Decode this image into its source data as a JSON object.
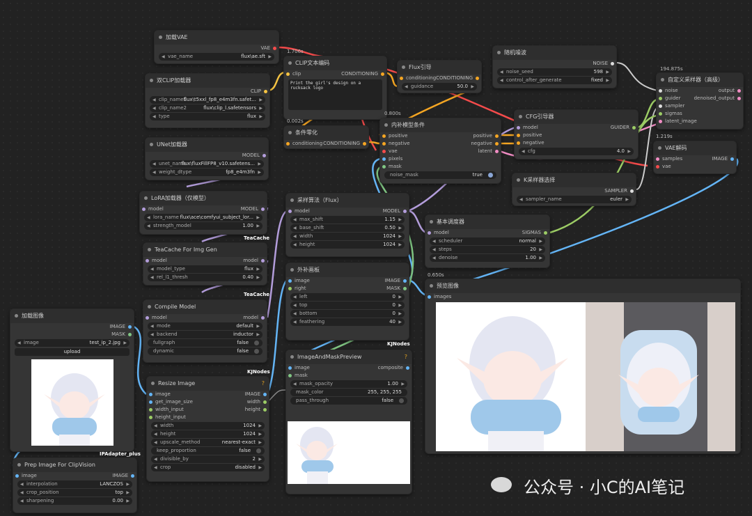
{
  "colors": {
    "model": "#b39ddb",
    "clip": "#f5c342",
    "vae": "#f44b4b",
    "conditioning": "#f5a623",
    "latent": "#f28dc4",
    "image": "#64b5f6",
    "mask": "#81c784",
    "sigmas": "#ffffff",
    "guider": "#9ccc65",
    "sampler": "#ffffff",
    "noise": "#ffffff"
  },
  "nodes": {
    "vae_loader": {
      "title": "加载VAE",
      "out": "VAE",
      "vae_name_k": "vae_name",
      "vae_name_v": "flux\\ae.sft"
    },
    "dual_clip": {
      "title": "双CLIP加载器",
      "out": "CLIP",
      "clip1_k": "clip_name1",
      "clip1_v": "flux\\t5xxl_fp8_e4m3fn.safet...",
      "clip2_k": "clip_name2",
      "clip2_v": "flux\\clip_l.safetensors",
      "type_k": "type",
      "type_v": "flux"
    },
    "unet": {
      "title": "UNet加载器",
      "out": "MODEL",
      "unet_k": "unet_name",
      "unet_v": "flux\\fluxFillFP8_v10.safetens...",
      "dtype_k": "weight_dtype",
      "dtype_v": "fp8_e4m3fn"
    },
    "lora": {
      "title": "LoRA加载器（仅模型）",
      "in": "model",
      "out": "MODEL",
      "lora_k": "lora_name",
      "lora_v": "flux\\ace\\comfyui_subject_lor...",
      "str_k": "strength_model",
      "str_v": "1.00",
      "tag": "TeaCache"
    },
    "teacache": {
      "title": "TeaCache For Img Gen",
      "in": "model",
      "out": "model",
      "mt_k": "model_type",
      "mt_v": "flux",
      "rel_k": "rel_l1_thresh",
      "rel_v": "0.40",
      "tag": "TeaCache"
    },
    "compile": {
      "title": "Compile Model",
      "in": "model",
      "out": "model",
      "mode_k": "mode",
      "mode_v": "default",
      "backend_k": "backend",
      "backend_v": "inductor",
      "fg_k": "fullgraph",
      "fg_v": "false",
      "dyn_k": "dynamic",
      "dyn_v": "false",
      "tag": "KJNodes"
    },
    "load_image": {
      "title": "加载图像",
      "out1": "IMAGE",
      "out2": "MASK",
      "img_k": "image",
      "img_v": "test_ip_2.jpg",
      "upload": "upload",
      "tag": "IPAdapter_plus"
    },
    "prep_image": {
      "title": "Prep Image For ClipVision",
      "in": "image",
      "out": "IMAGE",
      "interp_k": "interpolation",
      "interp_v": "LANCZOS",
      "crop_k": "crop_position",
      "crop_v": "top",
      "sharp_k": "sharpening",
      "sharp_v": "0.00"
    },
    "resize": {
      "title": "Resize Image",
      "in1": "image",
      "in2": "get_image_size",
      "in3": "width_input",
      "in4": "height_input",
      "out1": "IMAGE",
      "out2": "width",
      "out3": "height",
      "w_k": "width",
      "w_v": "1024",
      "h_k": "height",
      "h_v": "1024",
      "up_k": "upscale_method",
      "up_v": "nearest-exact",
      "kp_k": "keep_proportion",
      "kp_v": "false",
      "div_k": "divisible_by",
      "div_v": "2",
      "crop_k": "crop",
      "crop_v": "disabled",
      "help": "?"
    },
    "clip_text": {
      "title": "CLIP文本编码",
      "in": "clip",
      "out": "CONDITIONING",
      "text": "Print the girl's design on a rucksack logo",
      "badge": "1.706s"
    },
    "cond_zero": {
      "title": "条件零化",
      "in": "conditioning",
      "out": "CONDITIONING",
      "badge": "0.002s"
    },
    "flux_guidance": {
      "title": "Flux引导",
      "in": "conditioning",
      "out": "CONDITIONING",
      "g_k": "guidance",
      "g_v": "50.0"
    },
    "inpaint_cond": {
      "title": "内补模型条件",
      "badge": "0.800s",
      "in1": "positive",
      "in2": "negative",
      "in3": "vae",
      "in4": "pixels",
      "in5": "mask",
      "out1": "positive",
      "out2": "negative",
      "out3": "latent",
      "nm_k": "noise_mask",
      "nm_v": "true"
    },
    "random_noise": {
      "title": "随机噪波",
      "out": "NOISE",
      "seed_k": "noise_seed",
      "seed_v": "598",
      "ctrl_k": "control_after_generate",
      "ctrl_v": "fixed"
    },
    "cfg_guider": {
      "title": "CFG引导器",
      "in1": "model",
      "in2": "positive",
      "in3": "negative",
      "out": "GUIDER",
      "cfg_k": "cfg",
      "cfg_v": "4.0"
    },
    "custom_sampler": {
      "title": "自定义采样器（高级）",
      "badge": "194.875s",
      "in1": "noise",
      "in2": "guider",
      "in3": "sampler",
      "in4": "sigmas",
      "in5": "latent_image",
      "out1": "output",
      "out2": "denoised_output"
    },
    "vae_decode": {
      "title": "VAE解码",
      "badge": "1.219s",
      "in1": "samples",
      "in2": "vae",
      "out": "IMAGE"
    },
    "ksampler_select": {
      "title": "K采样器选择",
      "out": "SAMPLER",
      "s_k": "sampler_name",
      "s_v": "euler"
    },
    "model_sampling": {
      "title": "采样算法（Flux）",
      "in": "model",
      "out": "MODEL",
      "ms_k": "max_shift",
      "ms_v": "1.15",
      "bs_k": "base_shift",
      "bs_v": "0.50",
      "w_k": "width",
      "w_v": "1024",
      "h_k": "height",
      "h_v": "1024"
    },
    "basic_scheduler": {
      "title": "基本调度器",
      "in": "model",
      "out": "SIGMAS",
      "sch_k": "scheduler",
      "sch_v": "normal",
      "st_k": "steps",
      "st_v": "20",
      "dn_k": "denoise",
      "dn_v": "1.00"
    },
    "outpaint": {
      "title": "外补画板",
      "in1": "image",
      "in2": "right",
      "out1": "IMAGE",
      "out2": "MASK",
      "l_k": "left",
      "l_v": "0",
      "t_k": "top",
      "t_v": "0",
      "b_k": "bottom",
      "b_v": "0",
      "f_k": "feathering",
      "f_v": "40",
      "tag": "KJNodes"
    },
    "img_mask_preview": {
      "title": "ImageAndMaskPreview",
      "in1": "image",
      "in2": "mask",
      "out": "composite",
      "mo_k": "mask_opacity",
      "mo_v": "1.00",
      "mc_k": "mask_color",
      "mc_v": "255, 255, 255",
      "pt_k": "pass_through",
      "pt_v": "false",
      "help": "?"
    },
    "preview": {
      "title": "预览图像",
      "badge": "0.650s",
      "in": "images"
    }
  },
  "watermark": "公众号 · 小C的AI笔记"
}
